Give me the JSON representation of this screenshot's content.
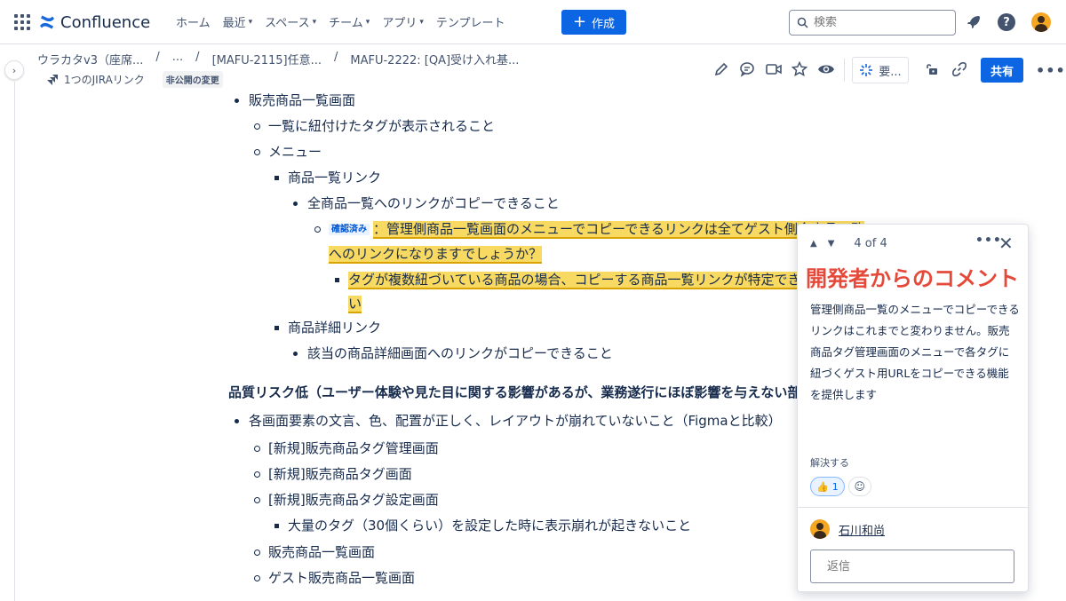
{
  "nav": {
    "logo_text": "Confluence",
    "items": [
      {
        "label": "ホーム",
        "has_dropdown": false
      },
      {
        "label": "最近",
        "has_dropdown": true
      },
      {
        "label": "スペース",
        "has_dropdown": true
      },
      {
        "label": "チーム",
        "has_dropdown": true
      },
      {
        "label": "アプリ",
        "has_dropdown": true
      },
      {
        "label": "テンプレート",
        "has_dropdown": false
      }
    ],
    "create_label": "作成",
    "search_placeholder": "検索",
    "accent": "#0c66e4"
  },
  "breadcrumb": [
    "ウラカタv3（座席...",
    "...",
    "[MAFU-2115]任意...",
    "MAFU-2222: [QA]受け入れ基..."
  ],
  "page_meta": {
    "jira_link": "1つのJIRAリンク",
    "private_badge": "非公開の変更"
  },
  "toolbar": {
    "ai_label": "要...",
    "share_label": "共有"
  },
  "content": {
    "i1": "販売商品一覧画面",
    "i2": "一覧に紐付けたタグが表示されること",
    "i3": "メニュー",
    "i4": "商品一覧リンク",
    "i5": "全商品一覧へのリンクがコピーできること",
    "confirmed_tag": "確認済み",
    "i6_line1": "：管理側商品一覧画面のメニューでコピーできるリンクは全てゲスト側全商品一覧",
    "i6_line2": "へのリンクになりますでしょうか？",
    "i7_line1": "タグが複数紐づいている商品の場合、コピーする商品一覧リンクが特定できないかもしれな",
    "i7_line2": "い",
    "i8": "商品詳細リンク",
    "i9": "該当の商品詳細画面へのリンクがコピーできること",
    "heading": "品質リスク低（ユーザー体験や見た目に関する影響があるが、業務遂行にほぼ影響を与えない部分）",
    "i10": "各画面要素の文言、色、配置が正しく、レイアウトが崩れていないこと（Figmaと比較）",
    "i11": "[新規]販売商品タグ管理画面",
    "i12": "[新規]販売商品タグ画面",
    "i13": "[新規]販売商品タグ設定画面",
    "i14": "大量のタグ（30個くらい）を設定した時に表示崩れが起きないこと",
    "i15": "販売商品一覧画面",
    "i16": "ゲスト販売商品一覧画面",
    "highlight_color": "#f8d962"
  },
  "comment": {
    "counter": "4 of 4",
    "title": "開発者からのコメント",
    "title_color": "#e5493a",
    "body": "管理側商品一覧のメニューでコピーできるリンクはこれまでと変わりません。販売商品タグ管理画面のメニューで各タグに紐づくゲスト用URLをコピーできる機能を提供します",
    "resolve_label": "解決する",
    "reaction_emoji": "👍",
    "reaction_count": "1",
    "author": "石川和尚",
    "reply_placeholder": "返信"
  }
}
